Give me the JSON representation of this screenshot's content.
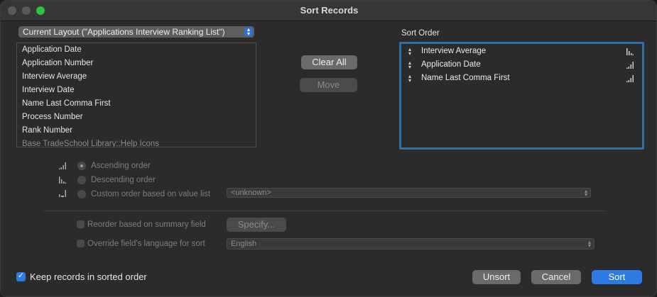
{
  "window": {
    "title": "Sort Records"
  },
  "layout_popup": {
    "value": "Current Layout (\"Applications Interview Ranking List\")"
  },
  "field_list": {
    "items": [
      "Application Date",
      "Application Number",
      "Interview Average",
      "Interview Date",
      "Name Last Comma First",
      "Process Number",
      "Rank Number",
      "Base TradeSchool Library::Help Icons"
    ]
  },
  "buttons": {
    "clear_all": "Clear All",
    "move": "Move",
    "specify": "Specify...",
    "unsort": "Unsort",
    "cancel": "Cancel",
    "sort": "Sort"
  },
  "sort_order": {
    "label": "Sort Order",
    "items": [
      {
        "name": "Interview Average",
        "order": "descending"
      },
      {
        "name": "Application Date",
        "order": "ascending"
      },
      {
        "name": "Name Last Comma First",
        "order": "ascending"
      }
    ]
  },
  "order_options": {
    "ascending": "Ascending order",
    "descending": "Descending order",
    "custom": "Custom order based on value list",
    "value_list": "<unknown>"
  },
  "options": {
    "reorder_summary": "Reorder based on summary field",
    "override_language": "Override field's language for sort",
    "language_value": "English",
    "keep_sorted": "Keep records in sorted order"
  },
  "colors": {
    "accent": "#2c7be5",
    "focus_ring": "#2e6fa8",
    "window_bg": "#2b2b2b"
  }
}
